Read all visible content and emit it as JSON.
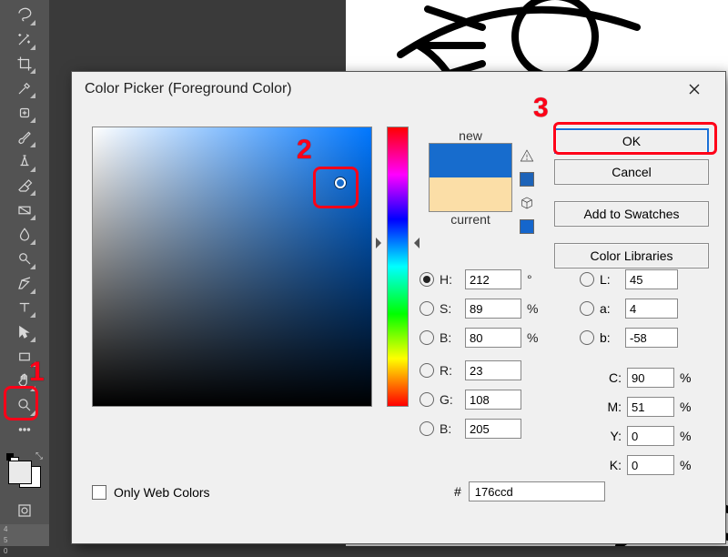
{
  "dialog": {
    "title": "Color Picker (Foreground Color)",
    "buttons": {
      "ok": "OK",
      "cancel": "Cancel",
      "add_swatches": "Add to Swatches",
      "color_libraries": "Color Libraries"
    },
    "preview": {
      "new_label": "new",
      "current_label": "current"
    },
    "only_web_colors": "Only Web Colors",
    "hex_prefix": "#",
    "hex_value": "176ccd",
    "color": {
      "new_hex": "#176ccd",
      "current_hex": "#fbdea7",
      "hue_deg": 212
    },
    "hsb": {
      "h_label": "H:",
      "h": "212",
      "h_unit": "°",
      "s_label": "S:",
      "s": "89",
      "s_unit": "%",
      "b_label": "B:",
      "b": "80",
      "b_unit": "%"
    },
    "rgb": {
      "r_label": "R:",
      "r": "23",
      "g_label": "G:",
      "g": "108",
      "b2_label": "B:",
      "b2": "205"
    },
    "lab": {
      "l_label": "L:",
      "l": "45",
      "a_label": "a:",
      "a": "4",
      "b_label": "b:",
      "b": "-58"
    },
    "cmyk": {
      "c_label": "C:",
      "c": "90",
      "m_label": "M:",
      "m": "51",
      "y_label": "Y:",
      "y": "0",
      "k_label": "K:",
      "k": "0",
      "unit": "%"
    },
    "selected_radio": "H"
  },
  "annotations": {
    "n1": "1",
    "n2": "2",
    "n3": "3"
  },
  "ruler": "4\n5\n0"
}
